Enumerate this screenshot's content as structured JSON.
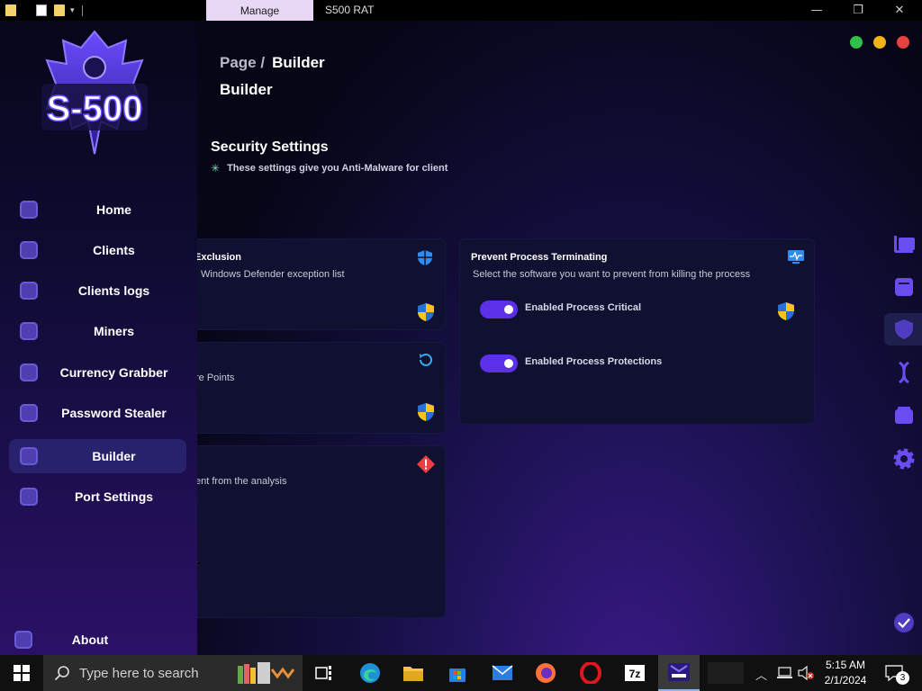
{
  "titlebar": {
    "manage_tab": "Manage",
    "window_title": "S500 RAT",
    "minimize_icon": "minimize-icon",
    "maximize_icon": "restore-icon",
    "close_icon": "close-icon"
  },
  "logo_text": "S-500",
  "sidebar": {
    "items": [
      {
        "label": "Home",
        "icon": "home-icon",
        "active": false
      },
      {
        "label": "Clients",
        "icon": "clients-icon",
        "active": false
      },
      {
        "label": "Clients logs",
        "icon": "clients-logs-icon",
        "active": false
      },
      {
        "label": "Miners",
        "icon": "miners-icon",
        "active": false
      },
      {
        "label": "Currency Grabber",
        "icon": "currency-grabber-icon",
        "active": false
      },
      {
        "label": "Password Stealer",
        "icon": "password-stealer-icon",
        "active": false
      },
      {
        "label": "Builder",
        "icon": "builder-icon",
        "active": true
      },
      {
        "label": "Port Settings",
        "icon": "port-settings-icon",
        "active": false
      }
    ],
    "about": {
      "label": "About",
      "icon": "user-icon"
    }
  },
  "window_dots": {
    "green": "#2fbf4a",
    "yellow": "#f0b215",
    "red": "#e8423f"
  },
  "breadcrumb": {
    "prefix": "Page /",
    "current": "Builder"
  },
  "page_title": "Builder",
  "section": {
    "title": "Security Settings",
    "subtitle": "These settings give you Anti-Malware for client"
  },
  "cards": {
    "exclusion": {
      "title": "Exclusion",
      "desc": "Windows Defender exception list",
      "icon": "shield-icon"
    },
    "restore": {
      "desc": "re Points",
      "icon": "refresh-icon"
    },
    "analysis": {
      "desc": "ent from the analysis",
      "icon": "warning-icon"
    },
    "process": {
      "title": "Prevent Process Terminating",
      "desc": "Select the software you want to prevent from killing the process",
      "icon": "monitor-icon",
      "toggles": [
        {
          "label": "Enabled Process Critical",
          "on": true
        },
        {
          "label": "Enabled Process Protections",
          "on": true
        }
      ]
    }
  },
  "right_icons": [
    "tools-icon",
    "window-icon",
    "shield-icon",
    "dna-icon",
    "wallet-icon",
    "gear-icon",
    "check-circle-icon"
  ],
  "taskbar": {
    "search_placeholder": "Type here to search",
    "time": "5:15 AM",
    "date": "2/1/2024",
    "notifications": "3",
    "apps": [
      "task-view-icon",
      "edge-icon",
      "file-explorer-icon",
      "store-icon",
      "mail-icon",
      "firefox-icon",
      "opera-icon",
      "7zip-icon",
      "s500-icon"
    ]
  },
  "accent": "#5b30e8"
}
